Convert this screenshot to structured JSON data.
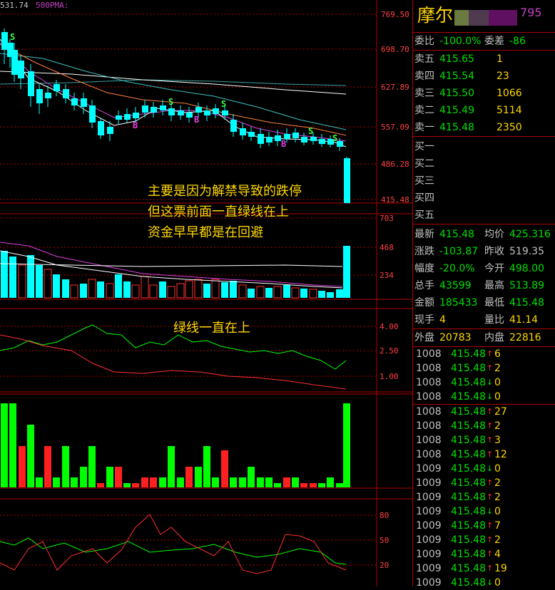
{
  "chart": {
    "top_left_label": "531.74",
    "ma_label": "500PMA:",
    "price_axis": [
      "769.50",
      "698.70",
      "627.89",
      "557.09",
      "486.28",
      "415.48"
    ],
    "vol_axis": [
      "703",
      "468",
      "234"
    ],
    "ind1_axis": [
      "4.00",
      "2.50",
      "1.00"
    ],
    "ind3_axis": [
      "80",
      "50",
      "20"
    ],
    "markers": [
      "S",
      "S",
      "S",
      "S",
      "B",
      "B",
      "B",
      "S"
    ],
    "colors": {
      "up": "#ff3030",
      "down": "#00ffff",
      "grid": "#b00000",
      "green": "#00ff00"
    }
  },
  "annotations": {
    "main": [
      "主要是因为解禁导致的跌停",
      "但这票前面一直绿线在上",
      "资金早早都是在回避"
    ],
    "indicator": "绿线一直在上"
  },
  "quote": {
    "name": "摩尔",
    "code_suffix": "795",
    "wb_label": "委比",
    "wb_value": "-100.0%",
    "wc_label": "委差",
    "wc_value": "-86",
    "sells": [
      {
        "label": "卖五",
        "price": "415.65",
        "vol": "1"
      },
      {
        "label": "卖四",
        "price": "415.54",
        "vol": "23"
      },
      {
        "label": "卖三",
        "price": "415.50",
        "vol": "1066"
      },
      {
        "label": "卖二",
        "price": "415.49",
        "vol": "5114"
      },
      {
        "label": "卖一",
        "price": "415.48",
        "vol": "2350"
      }
    ],
    "buys": [
      {
        "label": "买一"
      },
      {
        "label": "买二"
      },
      {
        "label": "买三"
      },
      {
        "label": "买四"
      },
      {
        "label": "买五"
      }
    ],
    "stats": [
      {
        "l1": "最新",
        "v1": "415.48",
        "l2": "均价",
        "v2": "425.316"
      },
      {
        "l1": "涨跌",
        "v1": "-103.87",
        "l2": "昨收",
        "v2": "519.35"
      },
      {
        "l1": "幅度",
        "v1": "-20.0%",
        "l2": "今开",
        "v2": "498.00"
      },
      {
        "l1": "总手",
        "v1": "43599",
        "l2": "最高",
        "v2": "513.89"
      },
      {
        "l1": "金额",
        "v1": "185433",
        "l2": "最低",
        "v2": "415.48"
      },
      {
        "l1": "现手",
        "v1": "4",
        "l2": "量比",
        "v2": "41.14"
      }
    ],
    "outer_label": "外盘",
    "outer_value": "20783",
    "inner_label": "内盘",
    "inner_value": "22816",
    "ticks": [
      {
        "time": "1008",
        "price": "415.48",
        "arrow": "↑",
        "vol": "6"
      },
      {
        "time": "1008",
        "price": "415.48",
        "arrow": "↑",
        "vol": "2"
      },
      {
        "time": "1008",
        "price": "415.48",
        "arrow": "↓",
        "vol": "0"
      },
      {
        "time": "1008",
        "price": "415.48",
        "arrow": "↓",
        "vol": "0"
      },
      {
        "time": "1008",
        "price": "415.48",
        "arrow": "↑",
        "vol": "27"
      },
      {
        "time": "1008",
        "price": "415.48",
        "arrow": "↑",
        "vol": "2"
      },
      {
        "time": "1008",
        "price": "415.48",
        "arrow": "↑",
        "vol": "3"
      },
      {
        "time": "1008",
        "price": "415.48",
        "arrow": "↑",
        "vol": "12"
      },
      {
        "time": "1009",
        "price": "415.48",
        "arrow": "↓",
        "vol": "0"
      },
      {
        "time": "1009",
        "price": "415.48",
        "arrow": "↑",
        "vol": "2"
      },
      {
        "time": "1009",
        "price": "415.48",
        "arrow": "↑",
        "vol": "2"
      },
      {
        "time": "1009",
        "price": "415.48",
        "arrow": "↓",
        "vol": "0"
      },
      {
        "time": "1009",
        "price": "415.48",
        "arrow": "↑",
        "vol": "7"
      },
      {
        "time": "1009",
        "price": "415.48",
        "arrow": "↑",
        "vol": "2"
      },
      {
        "time": "1009",
        "price": "415.48",
        "arrow": "↑",
        "vol": "4"
      },
      {
        "time": "1009",
        "price": "415.48",
        "arrow": "↑",
        "vol": "19"
      },
      {
        "time": "1009",
        "price": "415.48",
        "arrow": "↓",
        "vol": "0"
      }
    ]
  }
}
